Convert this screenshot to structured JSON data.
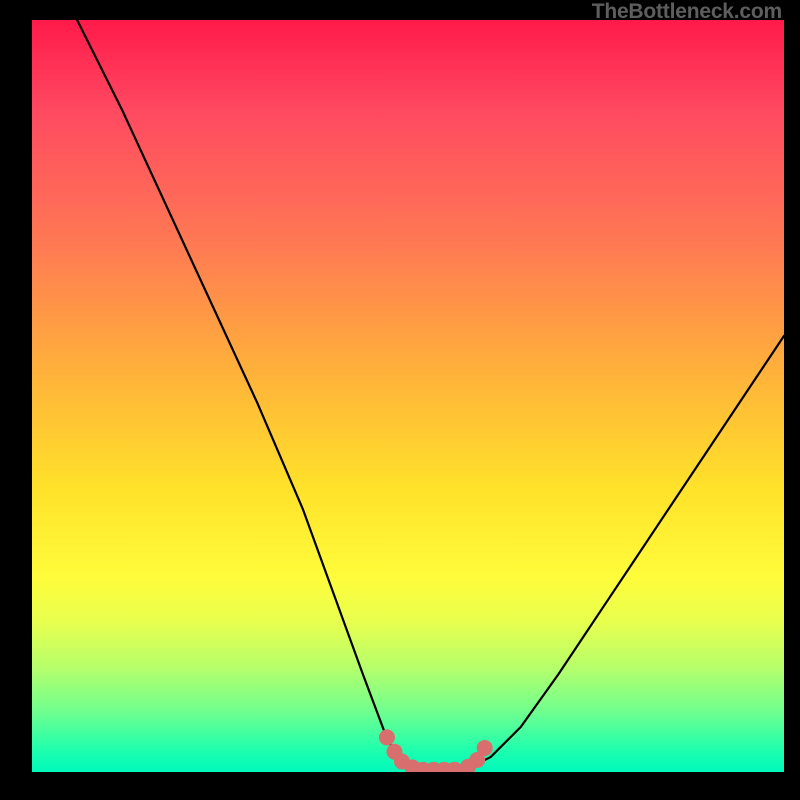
{
  "watermark": "TheBottleneck.com",
  "chart_data": {
    "type": "line",
    "title": "",
    "xlabel": "",
    "ylabel": "",
    "xlim": [
      0,
      100
    ],
    "ylim": [
      0,
      100
    ],
    "series": [
      {
        "name": "curve",
        "x": [
          6,
          12,
          18,
          24,
          30,
          36,
          40,
          44,
          47,
          48.5,
          50,
          52,
          54,
          56,
          58,
          61,
          65,
          70,
          76,
          84,
          92,
          100
        ],
        "y": [
          100,
          88,
          75,
          62,
          49,
          35,
          24,
          13,
          5,
          2,
          0.5,
          0,
          0,
          0,
          0.5,
          2,
          6,
          13,
          22,
          34,
          46,
          58
        ]
      }
    ],
    "markers": {
      "name": "dots",
      "x": [
        47.2,
        48.2,
        49.2,
        50.6,
        52.0,
        53.4,
        54.8,
        56.2,
        58.0,
        59.2,
        60.2
      ],
      "y": [
        4.6,
        2.7,
        1.4,
        0.6,
        0.3,
        0.3,
        0.3,
        0.3,
        0.7,
        1.6,
        3.2
      ],
      "colorHex": "#d96e6e",
      "radius": 8
    },
    "colors": {
      "curveHex": "#000000",
      "backgroundGradient": [
        "#ff1a4a",
        "#00f9bc"
      ]
    }
  }
}
